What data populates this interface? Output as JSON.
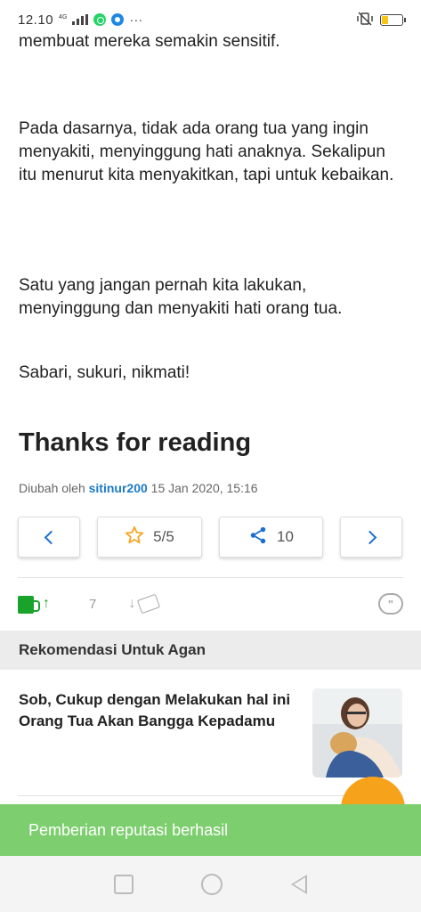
{
  "status_bar": {
    "time": "12.10",
    "network": "4G",
    "battery_level": 0.3
  },
  "article": {
    "p1": "membuat mereka semakin sensitif.",
    "p2": "Pada dasarnya, tidak ada orang tua yang ingin menyakiti, menyinggung hati anaknya. Sekalipun itu menurut kita menyakitkan, tapi untuk kebaikan.",
    "p3": "Satu yang jangan pernah kita lakukan, menyinggung dan menyakiti hati orang tua.",
    "p4": "Sabari, sukuri, nikmati!",
    "thanks": "Thanks for reading"
  },
  "meta": {
    "prefix": "Diubah oleh",
    "author": "sitinur200",
    "datetime": "15 Jan 2020, 15:16"
  },
  "actions": {
    "rating": "5/5",
    "share_count": "10"
  },
  "reputation": {
    "count": "7"
  },
  "recommendation": {
    "header": "Rekomendasi Untuk Agan",
    "title": "Sob, Cukup dengan Melakukan hal ini Orang Tua Akan Bangga Kepadamu"
  },
  "toast": "Pemberian reputasi berhasil",
  "colors": {
    "accent_blue": "#1a6fd0",
    "rep_green": "#1aa32a",
    "toast_green": "#7dce6e",
    "fab_orange": "#f7a21b"
  }
}
